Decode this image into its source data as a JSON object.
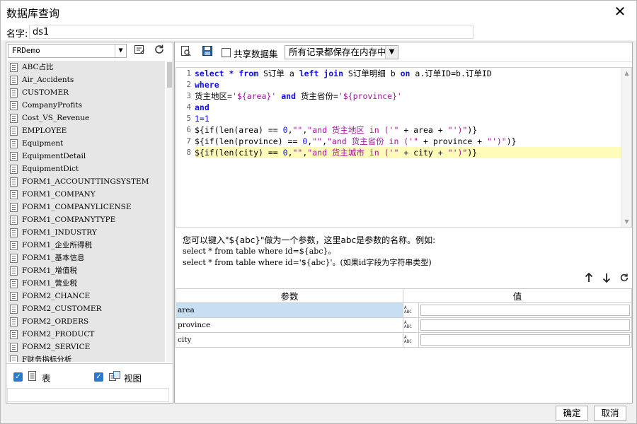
{
  "window": {
    "title": "数据库查询",
    "close_glyph": "✕"
  },
  "name_row": {
    "label": "名字:",
    "value": "ds1"
  },
  "left_panel": {
    "connection": "FRDemo",
    "tables": [
      "ABC占比",
      "Air_Accidents",
      "CUSTOMER",
      "CompanyProfits",
      "Cost_VS_Revenue",
      "EMPLOYEE",
      "Equipment",
      "EquipmentDetail",
      "EquipmentDict",
      "FORM1_ACCOUNTTINGSYSTEM",
      "FORM1_COMPANY",
      "FORM1_COMPANYLICENSE",
      "FORM1_COMPANYTYPE",
      "FORM1_INDUSTRY",
      "FORM1_企业所得税",
      "FORM1_基本信息",
      "FORM1_增值税",
      "FORM1_营业税",
      "FORM2_CHANCE",
      "FORM2_CUSTOMER",
      "FORM2_ORDERS",
      "FORM2_PRODUCT",
      "FORM2_SERVICE",
      "F财务指标分析"
    ],
    "show_table_label": "表",
    "show_view_label": "视图"
  },
  "toolbar": {
    "share_label": "共享数据集",
    "memory_mode": "所有记录都保存在内存中"
  },
  "editor": {
    "line_numbers": [
      "1",
      "2",
      "3",
      "4",
      "5",
      "6",
      "7",
      "8"
    ],
    "highlight_line": 8
  },
  "hint": {
    "line1": "您可以键入\"${abc}\"做为一个参数，这里abc是参数的名称。例如:",
    "line2": "select * from table where id=${abc}。",
    "line3": "select * from table where id='${abc}'。(如果id字段为字符串类型)"
  },
  "params": {
    "header_name": "参数",
    "header_value": "值",
    "rows": [
      {
        "name": "area",
        "value": ""
      },
      {
        "name": "province",
        "value": ""
      },
      {
        "name": "city",
        "value": ""
      }
    ],
    "selected_row": 0
  },
  "footer": {
    "ok": "确定",
    "cancel": "取消"
  },
  "colors": {
    "keyword": "#1010ee",
    "string": "#a1159c",
    "highlight": "#fffbb8",
    "selection": "#c7dff2",
    "checkbox": "#2a7bd0"
  }
}
